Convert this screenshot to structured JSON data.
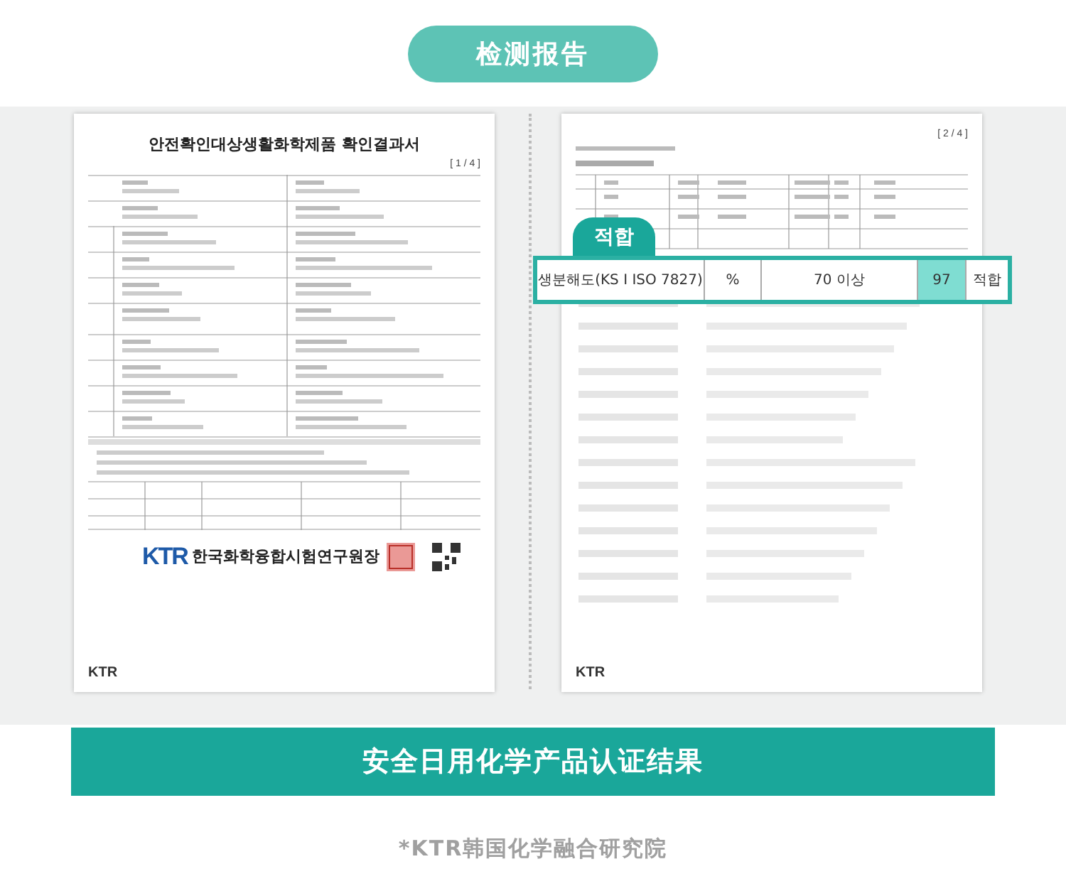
{
  "header": {
    "title": "检测报告"
  },
  "left_document": {
    "title": "안전확인대상생활화학제품 확인결과서",
    "page": "[ 1 / 4 ]",
    "logo": "KTR",
    "issuer": "한국화학융합시험연구원장",
    "footer_logo": "KTR"
  },
  "right_document": {
    "page": "[ 2 / 4 ]",
    "footer_logo": "KTR"
  },
  "highlight": {
    "badge": "적합",
    "cells": [
      {
        "text": "생분해도(KS I ISO 7827)",
        "highlighted": false
      },
      {
        "text": "%",
        "highlighted": false
      },
      {
        "text": "70 이상",
        "highlighted": false
      },
      {
        "text": "97",
        "highlighted": true
      },
      {
        "text": "적합",
        "highlighted": false
      }
    ]
  },
  "banner": {
    "text": "安全日用化学产品认证结果"
  },
  "footnote": "*KTR韩国化学融合研究院"
}
